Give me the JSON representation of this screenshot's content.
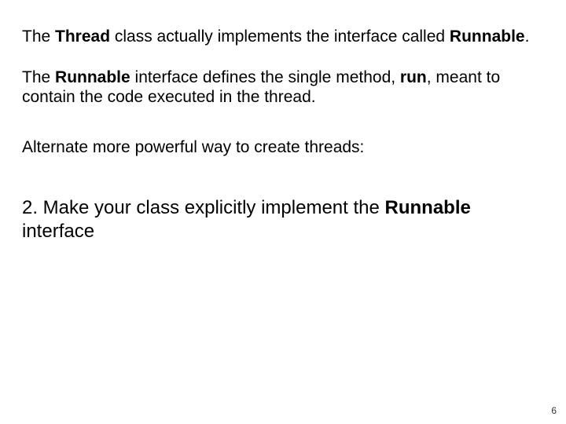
{
  "p1": {
    "t1": "The ",
    "t2": "Thread",
    "t3": " class actually implements the interface called ",
    "t4": "Runnable",
    "t5": "."
  },
  "p2": {
    "t1": "The ",
    "t2": "Runnable",
    "t3": " interface defines the single method, ",
    "t4": "run",
    "t5": ", meant to contain the code executed in the thread."
  },
  "p3": {
    "t1": "Alternate more powerful way to create threads:"
  },
  "p4": {
    "t1": "2. Make your class explicitly implement the ",
    "t2": "Runnable",
    "t3": " interface"
  },
  "page_number": "6"
}
